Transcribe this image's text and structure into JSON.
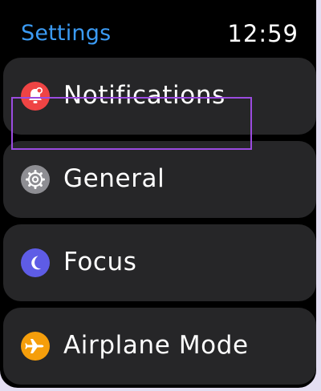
{
  "header": {
    "title": "Settings",
    "time": "12:59"
  },
  "menu": {
    "items": [
      {
        "label": "Notifications",
        "icon": "notification-bell-icon",
        "icon_color": "#EF4444"
      },
      {
        "label": "General",
        "icon": "gear-icon",
        "icon_color": "#8E8E93",
        "highlighted": true
      },
      {
        "label": "Focus",
        "icon": "moon-icon",
        "icon_color": "#5E5CE6"
      },
      {
        "label": "Airplane Mode",
        "icon": "airplane-icon",
        "icon_color": "#F59E0B"
      }
    ]
  },
  "colors": {
    "accent": "#3B9BF5",
    "highlight": "#9B4BE0",
    "row_background": "#262628"
  }
}
